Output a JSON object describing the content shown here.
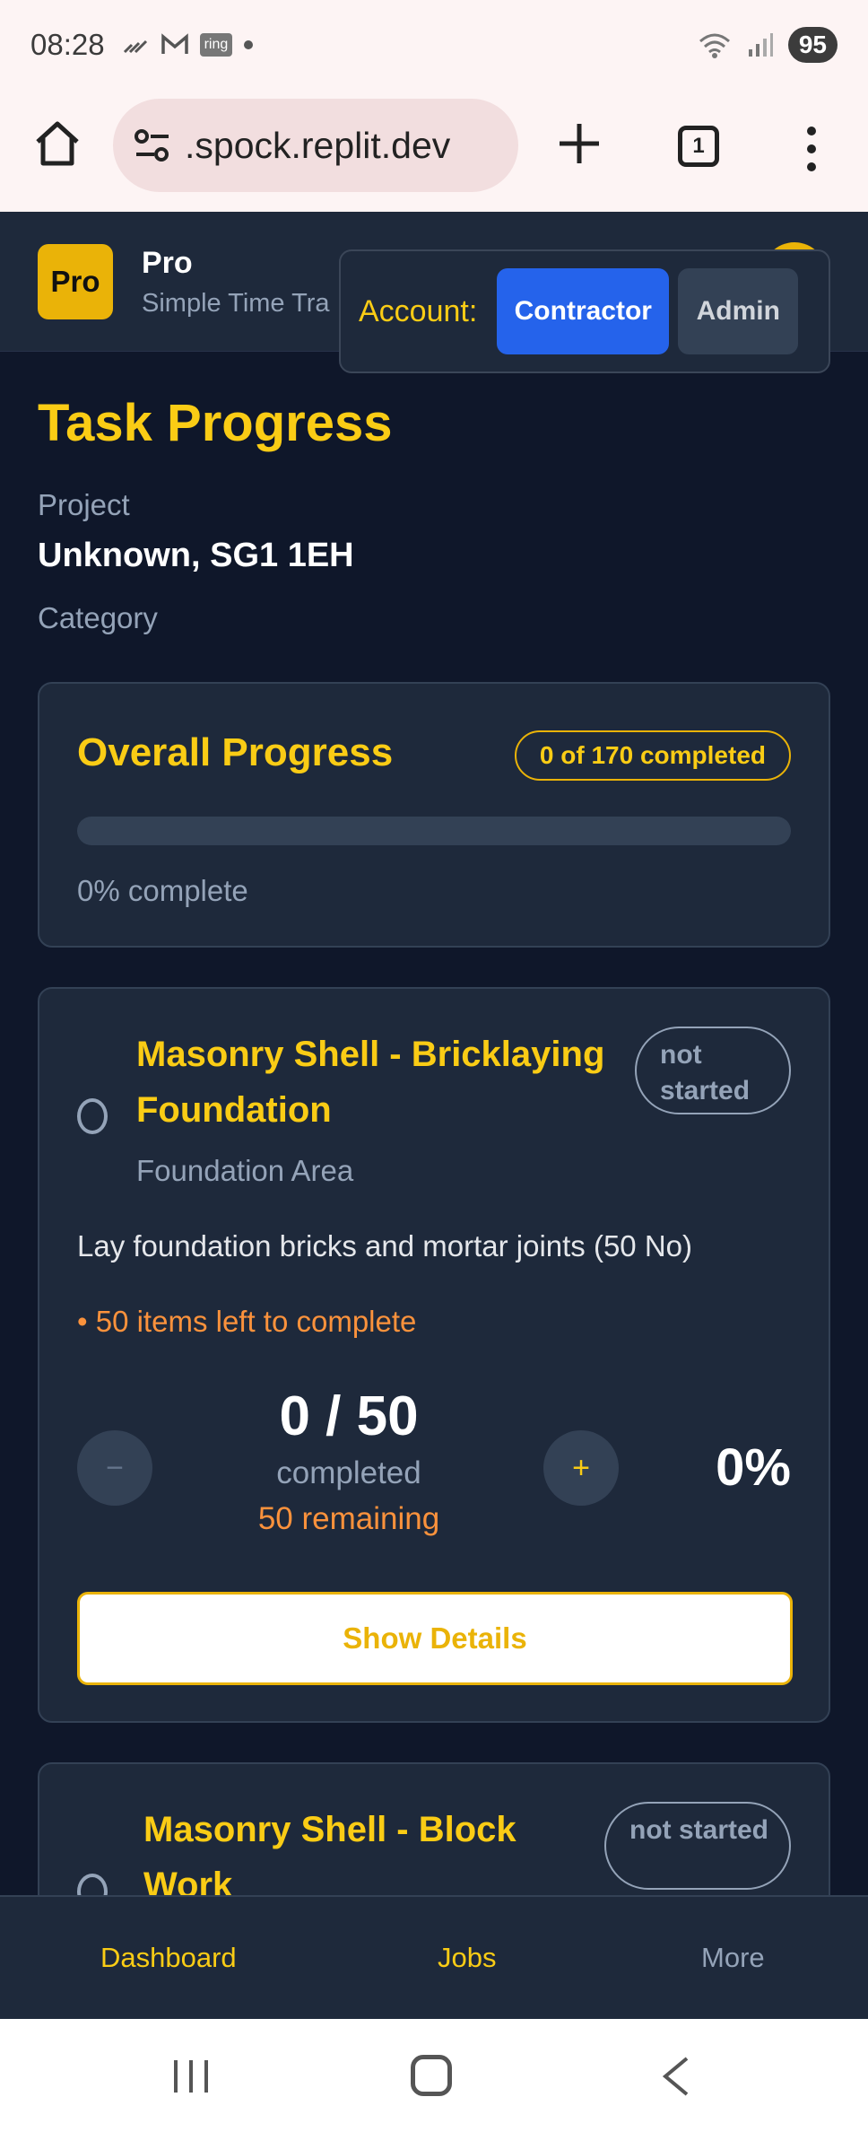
{
  "status_bar": {
    "time": "08:28",
    "notification_icons": [
      "missed-call-icon",
      "gmail-icon",
      "ring-app-icon",
      "dot-icon"
    ],
    "ring_badge": "ring",
    "battery": "95"
  },
  "browser": {
    "url": ".spock.replit.dev",
    "tab_count": "1"
  },
  "app_header": {
    "logo_text": "Pro",
    "app_name": "Pro",
    "app_subtitle": "Simple Time Tra",
    "account_label": "Account:",
    "contractor_label": "Contractor",
    "admin_label": "Admin",
    "active_account": "Contractor"
  },
  "page": {
    "title": "Task Progress",
    "project_label": "Project",
    "project_value": "Unknown, SG1 1EH",
    "category_label": "Category"
  },
  "overall": {
    "title": "Overall Progress",
    "badge": "0 of 170 completed",
    "progress_percent": 0,
    "percent_text": "0% complete"
  },
  "tasks": [
    {
      "title": "Masonry Shell - Bricklaying Foundation",
      "status": "not started",
      "area": "Foundation Area",
      "description": "Lay foundation bricks and mortar joints (50 No)",
      "items_left": "• 50 items left to complete",
      "count": "0 / 50",
      "completed_label": "completed",
      "remaining": "50 remaining",
      "percent": "0%",
      "minus_label": "−",
      "plus_label": "+",
      "details_label": "Show Details"
    },
    {
      "title": "Masonry Shell - Block Work",
      "status": "not started"
    }
  ],
  "bottom_nav": {
    "items": [
      {
        "label": "Dashboard"
      },
      {
        "label": "Jobs"
      },
      {
        "label": "More"
      }
    ]
  },
  "colors": {
    "background": "#0f172a",
    "card": "#1e293b",
    "accent": "#facc15",
    "primary_button": "#2563eb",
    "warning_text": "#fb923c"
  }
}
